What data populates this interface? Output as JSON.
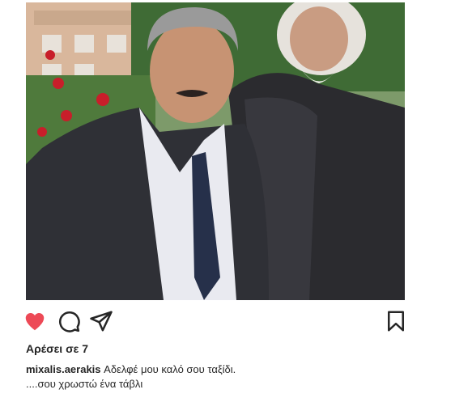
{
  "post": {
    "image_alt": "Two men standing together outdoors",
    "actions": {
      "like_icon": "heart-filled-icon",
      "comment_icon": "comment-icon",
      "share_icon": "send-icon",
      "save_icon": "bookmark-icon",
      "like_color": "#ed4956"
    },
    "likes_text": "Αρέσει σε 7",
    "caption": {
      "username": "mixalis.aerakis",
      "text_line1": "Αδελφέ μου καλό σου ταξίδι.",
      "text_line2": "....σου χρωστώ ένα τάβλι"
    }
  }
}
